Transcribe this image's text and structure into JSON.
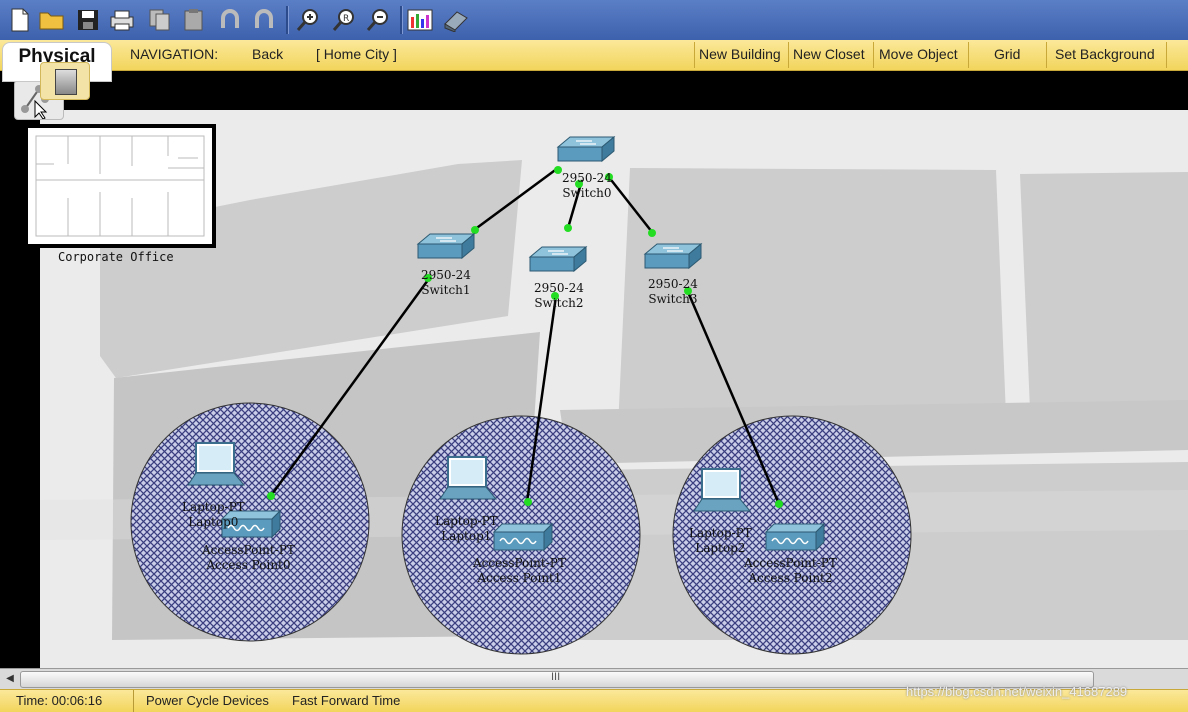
{
  "toolbar": {
    "buttons": [
      "new-file",
      "open-folder",
      "save",
      "print",
      "copy",
      "paste",
      "undo",
      "redo",
      "zoom-in",
      "zoom-reset",
      "zoom-out",
      "palette",
      "device-template"
    ]
  },
  "nav": {
    "tab_label": "Physical",
    "navigation_label": "NAVIGATION:",
    "back_label": "Back",
    "location_label": "[ Home City ]",
    "new_building": "New Building",
    "new_closet": "New Closet",
    "move_object": "Move Object",
    "grid": "Grid",
    "set_background": "Set Background"
  },
  "building": {
    "label": "Corporate Office"
  },
  "devices": {
    "switch0": {
      "model": "2950-24",
      "name": "Switch0"
    },
    "switch1": {
      "model": "2950-24",
      "name": "Switch1"
    },
    "switch2": {
      "model": "2950-24",
      "name": "Switch2"
    },
    "switch3": {
      "model": "2950-24",
      "name": "Switch3"
    },
    "laptop0": {
      "model": "Laptop-PT",
      "name": "Laptop0"
    },
    "laptop1": {
      "model": "Laptop-PT",
      "name": "Laptop1"
    },
    "laptop2": {
      "model": "Laptop-PT",
      "name": "Laptop2"
    },
    "ap0": {
      "model": "AccessPoint-PT",
      "name": "Access Point0"
    },
    "ap1": {
      "model": "AccessPoint-PT",
      "name": "Access Point1"
    },
    "ap2": {
      "model": "AccessPoint-PT",
      "name": "Access Point2"
    }
  },
  "scrollbar": {
    "grip": "III"
  },
  "status": {
    "time": "Time: 00:06:16",
    "power_cycle": "Power Cycle Devices",
    "fast_forward": "Fast Forward Time",
    "watermark": "https://blog.csdn.net/weixin_41687289"
  },
  "colors": {
    "link_dot": "#22dd22",
    "coverage": "#3a3f80",
    "nav_bar": "#f5dc6c"
  }
}
